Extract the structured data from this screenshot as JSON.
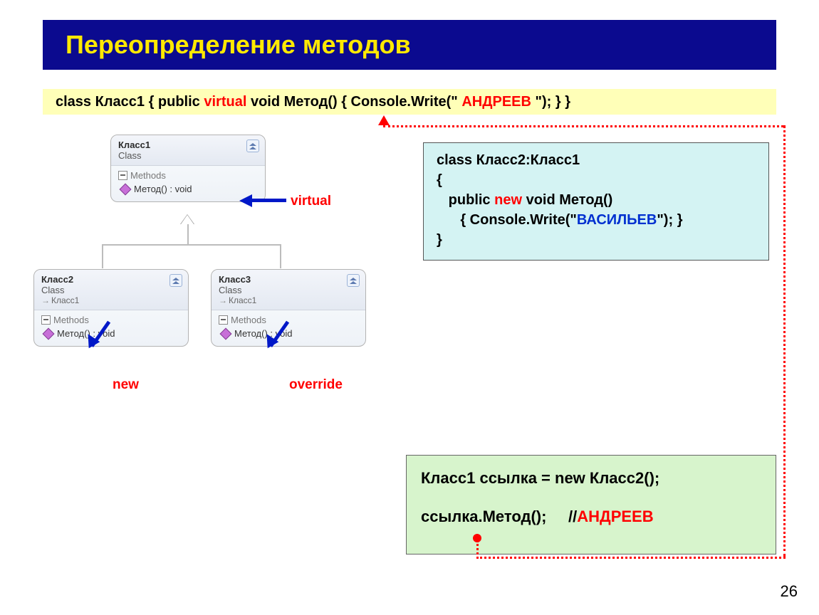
{
  "title": "Переопределение методов",
  "topcode": {
    "p1": "class Класс1  {   public ",
    "virtual": "virtual",
    "p2": " void Метод() { Console.Write(\"",
    "andreev": "АНДРЕЕВ",
    "p3": "\"); }   }"
  },
  "uml": {
    "classLabel": "Class",
    "methodsLabel": "Methods",
    "method": "Метод() : void",
    "c1": {
      "name": "Класс1"
    },
    "c2": {
      "name": "Класс2",
      "base": "Класс1"
    },
    "c3": {
      "name": "Класс3",
      "base": "Класс1"
    }
  },
  "annot": {
    "virtual": "virtual",
    "new": "new",
    "override": "override"
  },
  "code2": {
    "l1": "class Класс2:Класс1",
    "l2": "{",
    "l3a": "public",
    "newkw": "new",
    "l3b": "void Метод()",
    "l4a": "{ Console.Write(\"",
    "vasilyev": "ВАСИЛЬЕВ",
    "l4b": "\"); }",
    "l5": "}"
  },
  "res": {
    "l1": "Класс1 ссылка = new Класс2();",
    "l2a": "ссылка.Метод();",
    "l2b": "//",
    "l2c": "АНДРЕЕВ"
  },
  "page": "26"
}
